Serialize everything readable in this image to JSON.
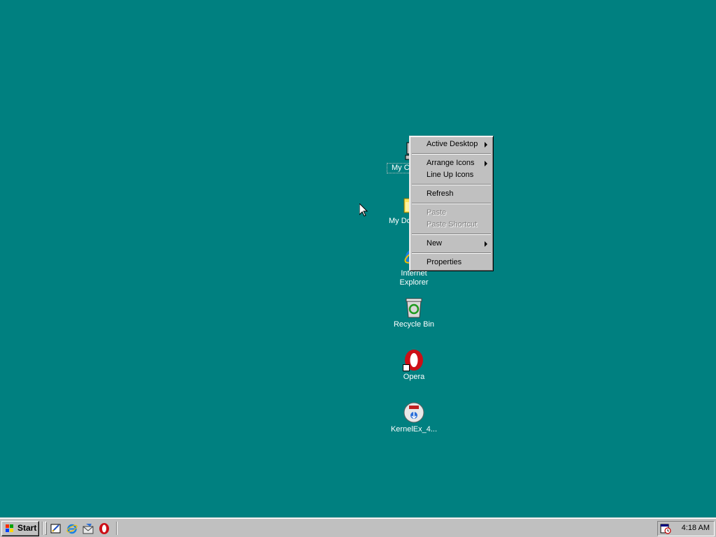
{
  "desktop": {
    "background_color": "#008080",
    "icons": [
      {
        "label": "My Computer",
        "visible_label": "My C",
        "icon": "my-computer-icon"
      },
      {
        "label": "My Documents",
        "visible_label": "My Do",
        "icon": "folder-icon"
      },
      {
        "label_line1": "Internet",
        "label_line2": "Explorer",
        "icon": "internet-explorer-icon"
      },
      {
        "label": "Recycle Bin",
        "icon": "recycle-bin-icon"
      },
      {
        "label": "Opera",
        "icon": "opera-icon"
      },
      {
        "label": "KernelEx_4...",
        "icon": "installer-disc-icon"
      }
    ]
  },
  "context_menu": {
    "items": [
      {
        "label": "Active Desktop",
        "submenu": true,
        "enabled": true
      },
      {
        "label": "Arrange Icons",
        "submenu": true,
        "enabled": true
      },
      {
        "label": "Line Up Icons",
        "submenu": false,
        "enabled": true
      },
      {
        "label": "Refresh",
        "submenu": false,
        "enabled": true
      },
      {
        "label": "Paste",
        "submenu": false,
        "enabled": false
      },
      {
        "label": "Paste Shortcut",
        "submenu": false,
        "enabled": false
      },
      {
        "label": "New",
        "submenu": true,
        "enabled": true
      },
      {
        "label": "Properties",
        "submenu": false,
        "enabled": true
      }
    ]
  },
  "taskbar": {
    "start_label": "Start",
    "quick_launch": [
      "show-desktop-icon",
      "internet-explorer-icon",
      "outlook-express-icon",
      "opera-icon"
    ],
    "tray": {
      "clock": "4:18 AM",
      "icon": "scheduler-icon"
    }
  },
  "colors": {
    "desktop": "#008080",
    "chrome": "#c0c0c0",
    "disabled_text": "#808080"
  }
}
